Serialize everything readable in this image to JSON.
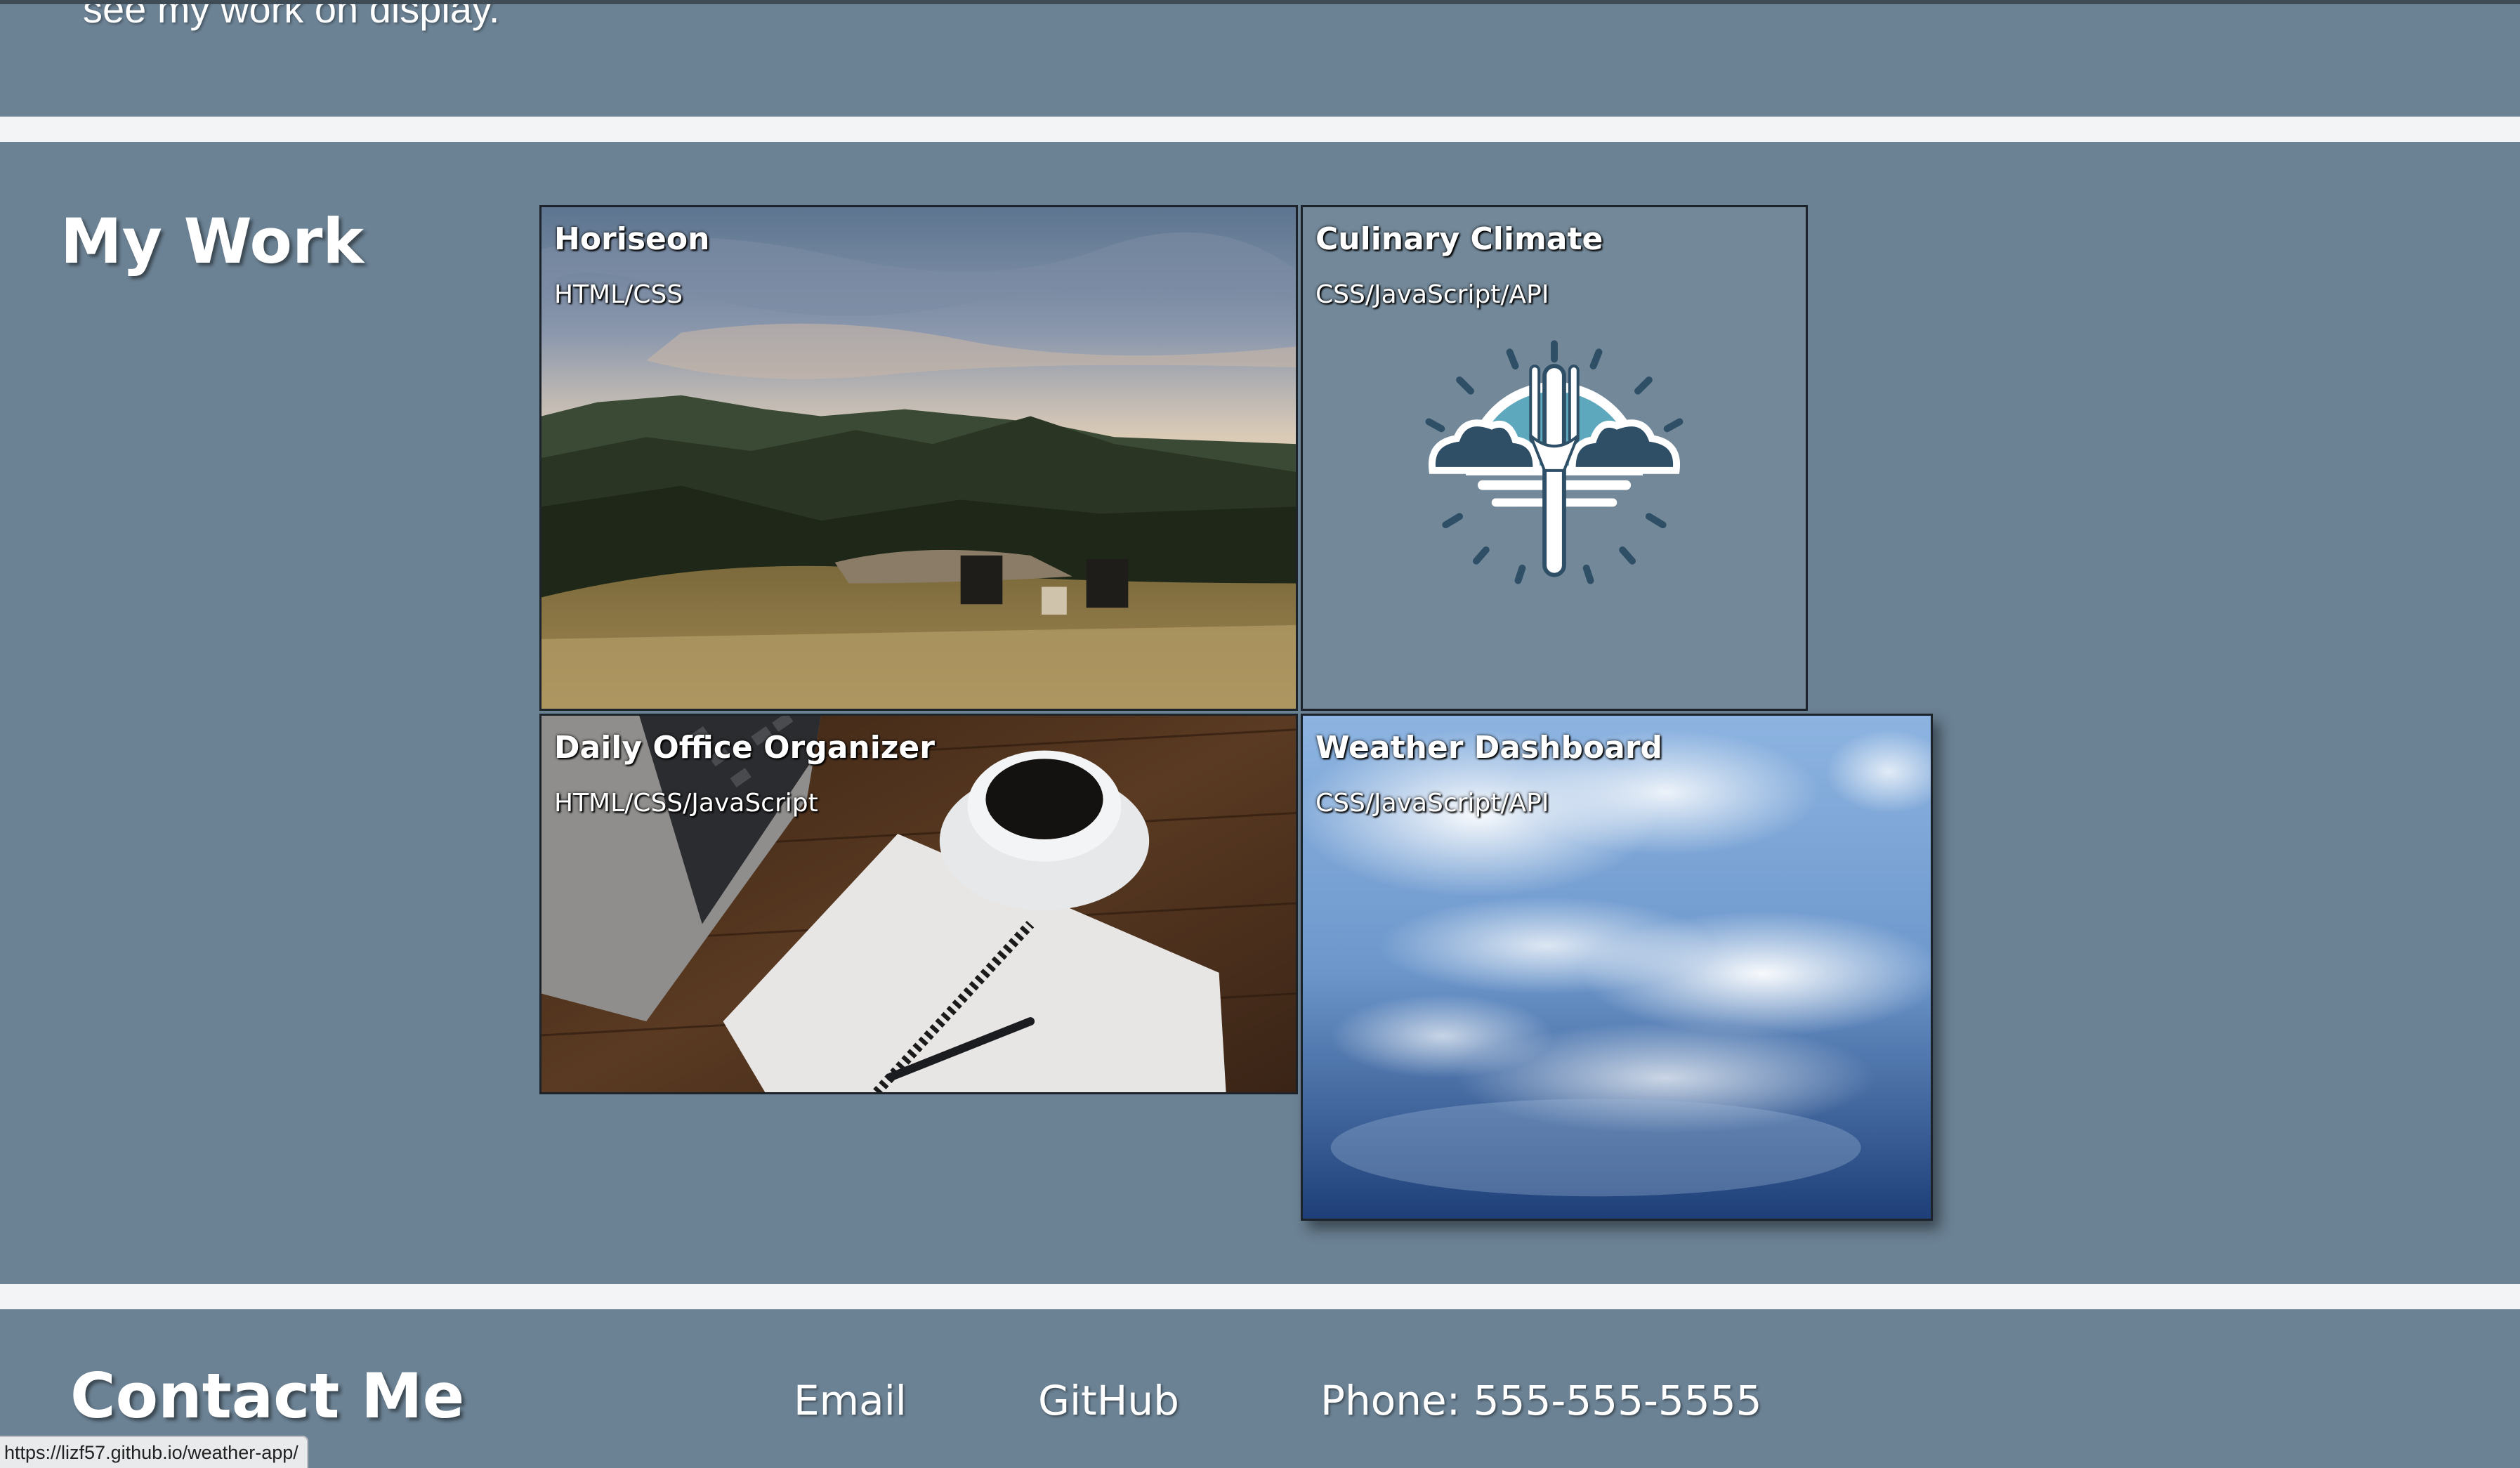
{
  "about": {
    "text": "see my work on display."
  },
  "work": {
    "heading": "My Work",
    "projects": [
      {
        "title": "Horiseon",
        "tech": "HTML/CSS"
      },
      {
        "title": "Culinary Climate",
        "tech": "CSS/JavaScript/API"
      },
      {
        "title": "Daily Office Organizer",
        "tech": "HTML/CSS/JavaScript"
      },
      {
        "title": "Weather Dashboard",
        "tech": "CSS/JavaScript/API"
      }
    ]
  },
  "contact": {
    "heading": "Contact Me",
    "email": "Email",
    "github": "GitHub",
    "phone": "Phone: 555-555-5555"
  },
  "status_bar": {
    "url": "https://lizf57.github.io/weather-app/"
  },
  "colors": {
    "page_background": "#6b8294",
    "divider": "#f3f4f5",
    "text": "#ffffff",
    "card_border": "#1c232a"
  },
  "icons": {
    "culinary_logo": "fork-with-clouds-sun-icon"
  }
}
